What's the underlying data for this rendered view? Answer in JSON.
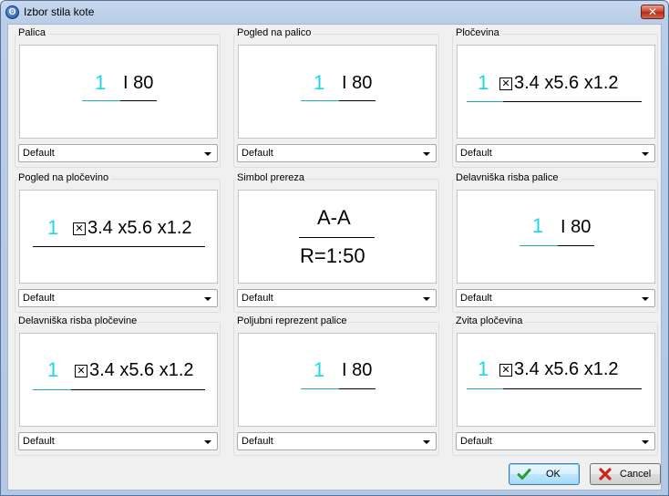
{
  "window": {
    "title": "Izbor stila kote"
  },
  "groups": [
    {
      "label": "Palica",
      "number": "1",
      "text": "I 80",
      "select": "Default"
    },
    {
      "label": "Pogled na palico",
      "number": "1",
      "text": "I 80",
      "select": "Default"
    },
    {
      "label": "Pločevina",
      "number": "1",
      "text": "3.4 x5.6 x1.2",
      "select": "Default"
    },
    {
      "label": "Pogled na pločevino",
      "number": "1",
      "text": "3.4 x5.6 x1.2",
      "select": "Default"
    },
    {
      "label": "Simbol prereza",
      "top_text": "A-A",
      "bottom_text": "R=1:50",
      "select": "Default"
    },
    {
      "label": "Delavniška risba palice",
      "number": "1",
      "text": "I 80",
      "select": "Default"
    },
    {
      "label": "Delavniška risba pločevine",
      "number": "1",
      "text": "3.4 x5.6 x1.2",
      "select": "Default"
    },
    {
      "label": "Poljubni reprezent palice",
      "number": "1",
      "text": "I 80",
      "select": "Default"
    },
    {
      "label": "Zvita pločevina",
      "number": "1",
      "text": "3.4 x5.6 x1.2",
      "select": "Default"
    }
  ],
  "buttons": {
    "ok": "OK",
    "cancel": "Cancel"
  },
  "icons": {
    "ok": "green-check-icon",
    "cancel": "red-x-icon",
    "app": "app-logo-icon"
  }
}
